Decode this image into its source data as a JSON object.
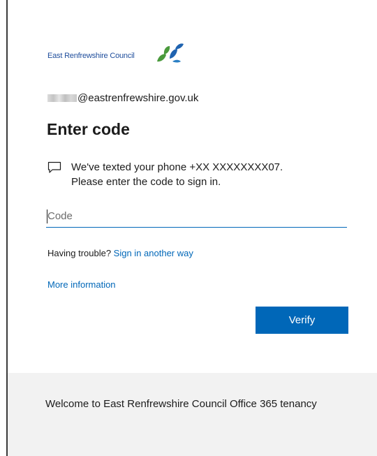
{
  "brand": {
    "name": "East Renfrewshire Council",
    "logo_icon": "leaf-bird-logo-icon",
    "colors": {
      "text_blue": "#1f4e9c",
      "leaf_green": "#4a9a3c",
      "leaf_blue": "#1f63b0"
    }
  },
  "identity": {
    "email_suffix": "@eastrenfrewshire.gov.uk"
  },
  "page": {
    "title": "Enter code"
  },
  "message": {
    "icon": "chat-bubble-icon",
    "line1": "We've texted your phone +XX XXXXXXXX07.",
    "line2": "Please enter the code to sign in."
  },
  "code_field": {
    "value": "",
    "placeholder": "Code"
  },
  "help": {
    "prefix": "Having trouble? ",
    "link_label": "Sign in another way",
    "more_info_label": "More information"
  },
  "actions": {
    "verify_label": "Verify",
    "accent": "#0067b8"
  },
  "footer": {
    "text": "Welcome to East Renfrewshire Council Office 365 tenancy",
    "background": "#f2f2f2"
  }
}
